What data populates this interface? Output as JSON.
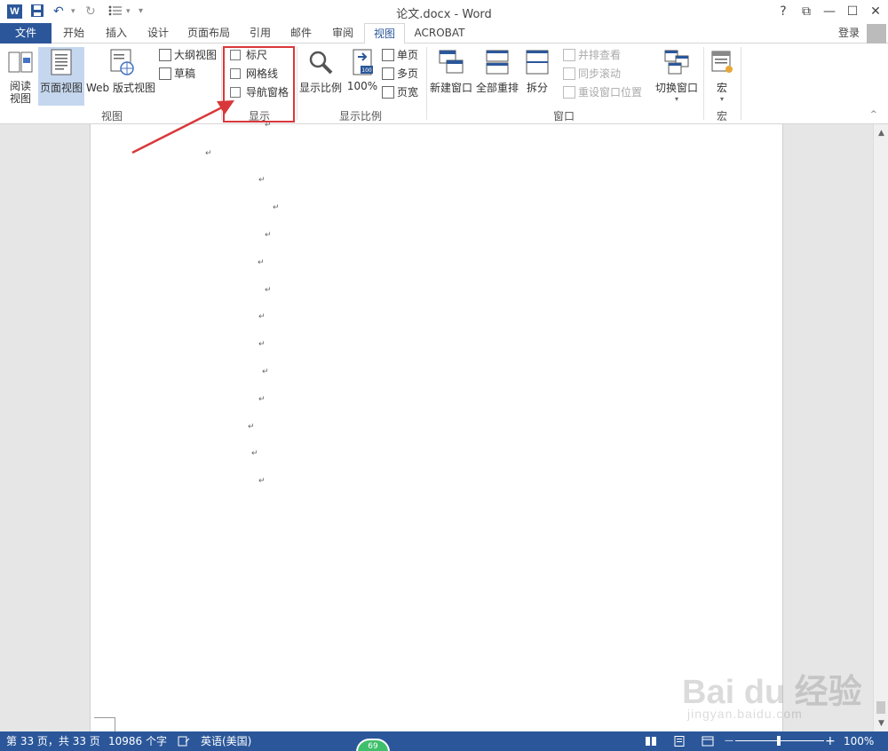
{
  "titlebar": {
    "title": "论文.docx - Word",
    "app_icon": "W",
    "help": "?",
    "restore": "⧉",
    "minimize": "—",
    "maximize": "☐",
    "close": "✕",
    "undo": "↶",
    "redo": "↻",
    "customize": "▾"
  },
  "tabs": {
    "file": "文件",
    "items": [
      "开始",
      "插入",
      "设计",
      "页面布局",
      "引用",
      "邮件",
      "审阅",
      "视图",
      "ACROBAT"
    ],
    "active": "视图",
    "login": "登录"
  },
  "ribbon": {
    "views": {
      "read_mode": "阅读\n视图",
      "print_layout": "页面视图",
      "web_layout": "Web 版式视图",
      "outline": "大纲视图",
      "draft": "草稿",
      "group_label": "视图"
    },
    "show": {
      "ruler": "标尺",
      "gridlines": "网格线",
      "nav_pane": "导航窗格",
      "group_label": "显示"
    },
    "zoom": {
      "zoom": "显示比例",
      "percent": "100%",
      "one_page": "单页",
      "multi_page": "多页",
      "page_width": "页宽",
      "group_label": "显示比例",
      "icon_num": "100"
    },
    "window": {
      "new_window": "新建窗口",
      "arrange_all": "全部重排",
      "split": "拆分",
      "side_by_side": "并排查看",
      "sync_scroll": "同步滚动",
      "reset_pos": "重设窗口位置",
      "switch": "切换窗口",
      "group_label": "窗口"
    },
    "macros": {
      "macros": "宏",
      "group_label": "宏"
    }
  },
  "document": {
    "paragraph_mark": "↵"
  },
  "statusbar": {
    "page": "第 33 页，共 33 页",
    "words": "10986 个字",
    "language": "英语(美国)",
    "zoom": "100%",
    "zoom_level_pct": 50,
    "minus": "—",
    "plus": "+"
  },
  "badge": {
    "value": "69"
  },
  "watermark": {
    "logo": "Bai du 经验",
    "url": "jingyan.baidu.com"
  },
  "colors": {
    "accent": "#2b579a",
    "highlight": "#d9383a"
  }
}
